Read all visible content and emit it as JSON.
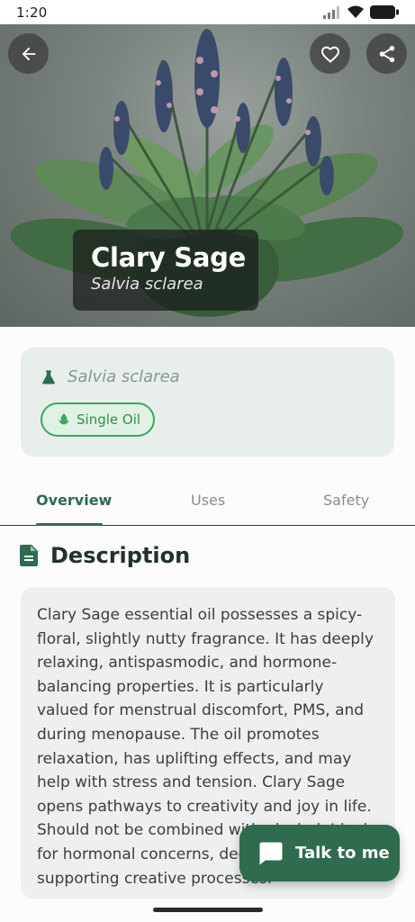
{
  "status_bar": {
    "time": "1:20"
  },
  "hero": {
    "name": "Clary Sage",
    "latin_name": "Salvia sclarea"
  },
  "info_card": {
    "latin_name": "Salvia sclarea",
    "chip_label": "Single Oil"
  },
  "tabs": [
    {
      "label": "Overview",
      "active": true
    },
    {
      "label": "Uses",
      "active": false
    },
    {
      "label": "Safety",
      "active": false
    }
  ],
  "description": {
    "heading": "Description",
    "text": "Clary Sage essential oil possesses a spicy-floral, slightly nutty fragrance. It has deeply relaxing, antispasmodic, and hormone-balancing properties. It is particularly valued for menstrual discomfort, PMS, and during menopause. The oil promotes relaxation, has uplifting effects, and may help with stress and tension. Clary Sage opens pathways to creativity and joy in life. Should not be combined with alcohol. Ideal for hormonal concerns, deep relaxation, and supporting creative processes."
  },
  "fab": {
    "label": "Talk to me"
  },
  "icons": {
    "back": "arrow-left-icon",
    "favorite": "heart-icon",
    "share": "share-icon",
    "flask": "flask-icon",
    "leaf": "leaf-icon",
    "document": "document-icon",
    "chat": "chat-bubble-icon"
  },
  "colors": {
    "primary": "#2f6b4f",
    "chip_border": "#3fa55f",
    "card_bg": "#e8efeb"
  }
}
